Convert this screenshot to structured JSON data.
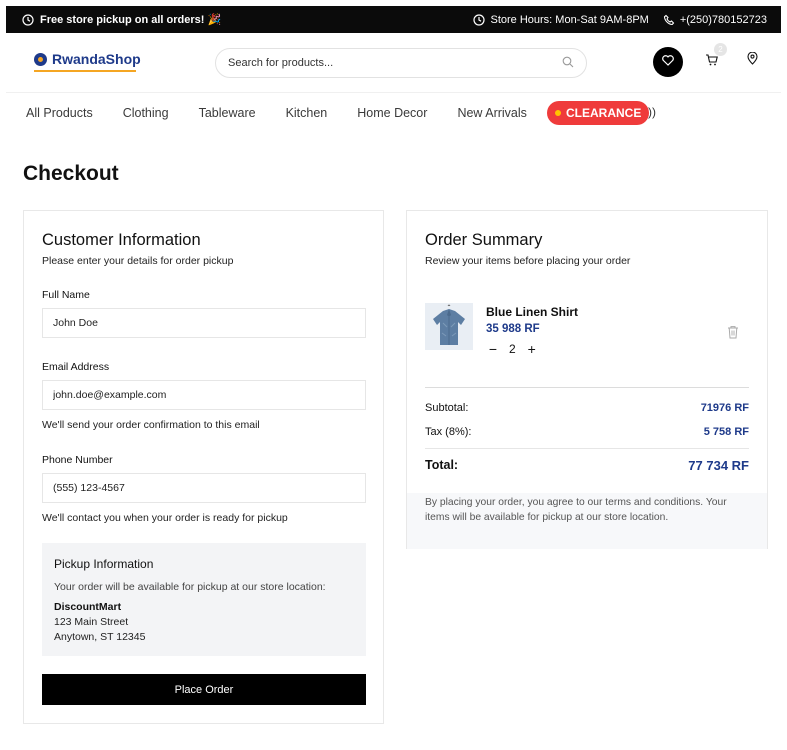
{
  "topbar": {
    "promo": "Free store pickup on all orders! 🎉",
    "hours": "Store Hours: Mon-Sat 9AM-8PM",
    "phone": "+(250)780152723"
  },
  "header": {
    "logo": "RwandaShop",
    "search_placeholder": "Search for products...",
    "cart_count": "2"
  },
  "nav": {
    "items": [
      "All Products",
      "Clothing",
      "Tableware",
      "Kitchen",
      "Home Decor",
      "New Arrivals"
    ],
    "clearance": "CLEARANCE",
    "clearance_suffix": "))"
  },
  "page": {
    "title": "Checkout"
  },
  "customer": {
    "title": "Customer Information",
    "subtitle": "Please enter your details for order pickup",
    "name_label": "Full Name",
    "name_value": "John Doe",
    "email_label": "Email Address",
    "email_value": "john.doe@example.com",
    "email_hint": "We'll send your order confirmation to this email",
    "phone_label": "Phone Number",
    "phone_value": "(555) 123-4567",
    "phone_hint": "We'll contact you when your order is ready for pickup",
    "pickup_title": "Pickup Information",
    "pickup_text": "Your order will be available for pickup at our store location:",
    "store_name": "DiscountMart",
    "store_addr1": "123 Main Street",
    "store_addr2": "Anytown, ST 12345",
    "place_order": "Place Order"
  },
  "summary": {
    "title": "Order Summary",
    "subtitle": "Review your items before placing your order",
    "item_name": "Blue Linen Shirt",
    "item_price": "35 988 RF",
    "item_qty": "2",
    "qty_minus": "−",
    "qty_plus": "+",
    "subtotal_label": "Subtotal:",
    "subtotal_value": "71976 RF",
    "tax_label": "Tax (8%):",
    "tax_value": "5 758 RF",
    "total_label": "Total:",
    "total_value": "77 734 RF",
    "terms": "By placing your order, you agree to our terms and conditions. Your items will be available for pickup at our store location."
  },
  "icons": {
    "clock": "clock-icon",
    "phone": "phone-icon",
    "search": "search-icon",
    "heart": "heart-icon",
    "cart": "cart-icon",
    "pin": "location-pin-icon",
    "trash": "trash-icon"
  },
  "colors": {
    "brand_blue": "#1e3a8a",
    "accent_orange": "#f5a623",
    "clearance_red": "#ef3b3b",
    "topbar_bg": "#0b0b0b"
  }
}
